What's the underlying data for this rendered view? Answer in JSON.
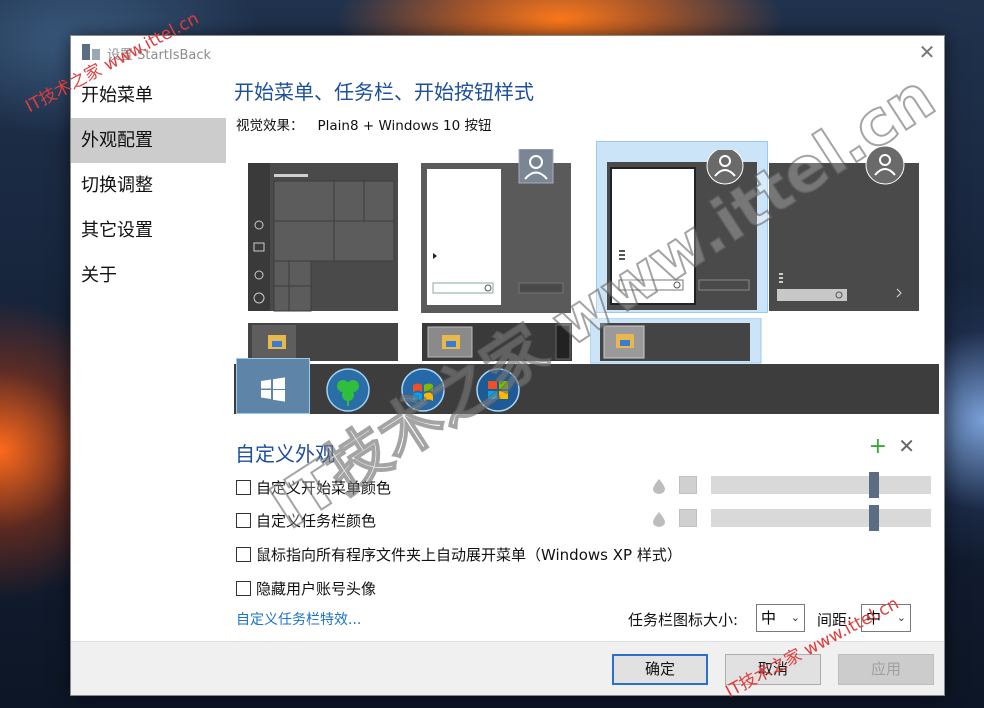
{
  "window": {
    "title": "设置 StartIsBack"
  },
  "sidebar": {
    "items": [
      {
        "label": "开始菜单"
      },
      {
        "label": "外观配置"
      },
      {
        "label": "切换调整"
      },
      {
        "label": "其它设置"
      },
      {
        "label": "关于"
      }
    ],
    "selected_index": 1
  },
  "main": {
    "section_title": "开始菜单、任务栏、开始按钮样式",
    "visual_label": "视觉效果：",
    "visual_value": "Plain8 + Windows 10 按钮",
    "selected_style_index": 2,
    "selected_orb_index": 0,
    "custom_title": "自定义外观",
    "plus_icon": "+",
    "remove_icon": "✕",
    "checkboxes": [
      {
        "label": "自定义开始菜单颜色",
        "checked": false
      },
      {
        "label": "自定义任务栏颜色",
        "checked": false
      },
      {
        "label": "鼠标指向所有程序文件夹上自动展开菜单（Windows XP 样式）",
        "checked": false
      },
      {
        "label": "隐藏用户账号头像",
        "checked": false
      }
    ],
    "menu_color_slider": 0.75,
    "taskbar_color_slider": 0.75,
    "taskbar_effects_link": "自定义任务栏特效...",
    "icon_size_label": "任务栏图标大小:",
    "icon_size_value": "中",
    "spacing_label": "间距:",
    "spacing_value": "中"
  },
  "footer": {
    "ok_label": "确定",
    "cancel_label": "取消",
    "apply_label": "应用"
  },
  "watermarks": {
    "top_left": "IT技术之家 www.ittel.cn",
    "bottom_right": "IT技术之家 www.ittel.cn",
    "center_big": "IT技术之家 www.ittel.cn"
  },
  "colors": {
    "accent_blue": "#1e4f9c",
    "link_blue": "#1a73c8",
    "selection": "#cce4f7",
    "taskbar": "#3d3d3d"
  }
}
